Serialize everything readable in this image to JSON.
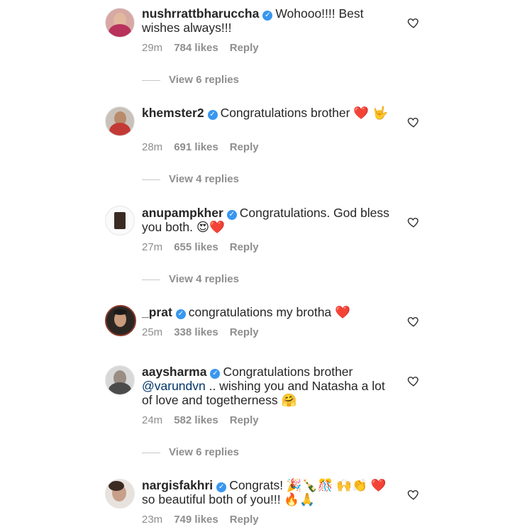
{
  "comments": [
    {
      "username": "nushrrattbharuccha",
      "text": "Wohooo!!!! Best wishes always!!!",
      "time": "29m",
      "likes": "784 likes",
      "reply": "Reply",
      "view_replies": "View 6 replies"
    },
    {
      "username": "khemster2",
      "text": "Congratulations brother ❤️ 🤟",
      "time": "28m",
      "likes": "691 likes",
      "reply": "Reply",
      "view_replies": "View 4 replies"
    },
    {
      "username": "anupampkher",
      "text": "Congratulations. God bless you both. 😍❤️",
      "time": "27m",
      "likes": "655 likes",
      "reply": "Reply",
      "view_replies": "View 4 replies"
    },
    {
      "username": "_prat",
      "text": "congratulations my brotha ❤️",
      "time": "25m",
      "likes": "338 likes",
      "reply": "Reply"
    },
    {
      "username": "aaysharma",
      "text_before": "Congratulations brother",
      "mention": "@varundvn",
      "text_after": ".. wishing you and Natasha a lot of love and togetherness 🤗",
      "time": "24m",
      "likes": "582 likes",
      "reply": "Reply",
      "view_replies": "View 6 replies"
    },
    {
      "username": "nargisfakhri",
      "text": "Congrats! 🎉🍾🎊 🙌👏 ❤️ so beautiful both of you!!! 🔥🙏",
      "time": "23m",
      "likes": "749 likes",
      "reply": "Reply"
    }
  ],
  "colors": {
    "text": "#262626",
    "meta": "#8e8e8e",
    "verified": "#3897f0",
    "mention": "#003569"
  },
  "icons": {
    "verified": "verified-badge-icon",
    "like": "heart-outline-icon"
  }
}
